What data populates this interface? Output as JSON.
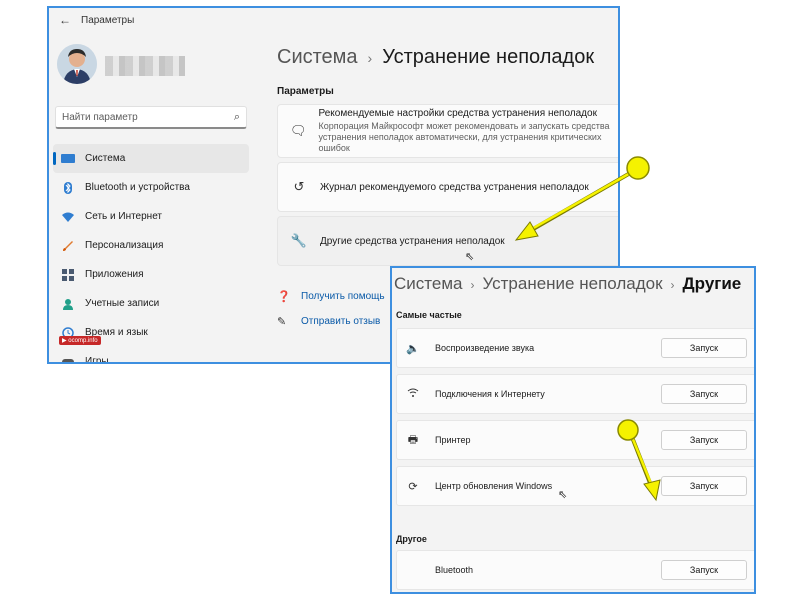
{
  "colors": {
    "accent": "#0067c0",
    "window_border": "#3d8fe0",
    "annotation": "#f5f200"
  },
  "window1": {
    "title": "Параметры",
    "search_placeholder": "Найти параметр",
    "nav": [
      {
        "label": "Система",
        "icon": "display-icon",
        "active": true
      },
      {
        "label": "Bluetooth и устройства",
        "icon": "bluetooth-icon"
      },
      {
        "label": "Сеть и Интернет",
        "icon": "wifi-icon"
      },
      {
        "label": "Персонализация",
        "icon": "brush-icon"
      },
      {
        "label": "Приложения",
        "icon": "apps-icon"
      },
      {
        "label": "Учетные записи",
        "icon": "person-icon"
      },
      {
        "label": "Время и язык",
        "icon": "globe-clock-icon"
      },
      {
        "label": "Игры",
        "icon": "gamepad-icon"
      }
    ],
    "breadcrumb": {
      "parent": "Система",
      "separator": "›",
      "current": "Устранение неполадок"
    },
    "section_label": "Параметры",
    "cards": [
      {
        "title": "Рекомендуемые настройки средства устранения неполадок",
        "subtitle": "Корпорация Майкрософт может рекомендовать и запускать средства устранения неполадок автоматически, для устранения критических ошибок",
        "icon": "chat-icon"
      },
      {
        "title": "Журнал рекомендуемого средства устранения неполадок",
        "icon": "history-icon"
      },
      {
        "title": "Другие средства устранения неполадок",
        "icon": "wrench-icon"
      }
    ],
    "links": [
      {
        "label": "Получить помощь",
        "icon": "help-icon"
      },
      {
        "label": "Отправить отзыв",
        "icon": "feedback-icon"
      }
    ]
  },
  "window2": {
    "breadcrumb": {
      "first": "Система",
      "second": "Устранение неполадок",
      "third": "Другие",
      "separator": "›"
    },
    "section_frequent": "Самые частые",
    "frequent": [
      {
        "label": "Воспроизведение звука",
        "icon": "speaker-icon",
        "button": "Запуск"
      },
      {
        "label": "Подключения к Интернету",
        "icon": "wifi-icon",
        "button": "Запуск"
      },
      {
        "label": "Принтер",
        "icon": "printer-icon",
        "button": "Запуск"
      },
      {
        "label": "Центр обновления Windows",
        "icon": "sync-icon",
        "button": "Запуск"
      }
    ],
    "section_other": "Другое",
    "other": [
      {
        "label": "Bluetooth",
        "icon": "bluetooth-icon",
        "button": "Запуск"
      }
    ]
  }
}
